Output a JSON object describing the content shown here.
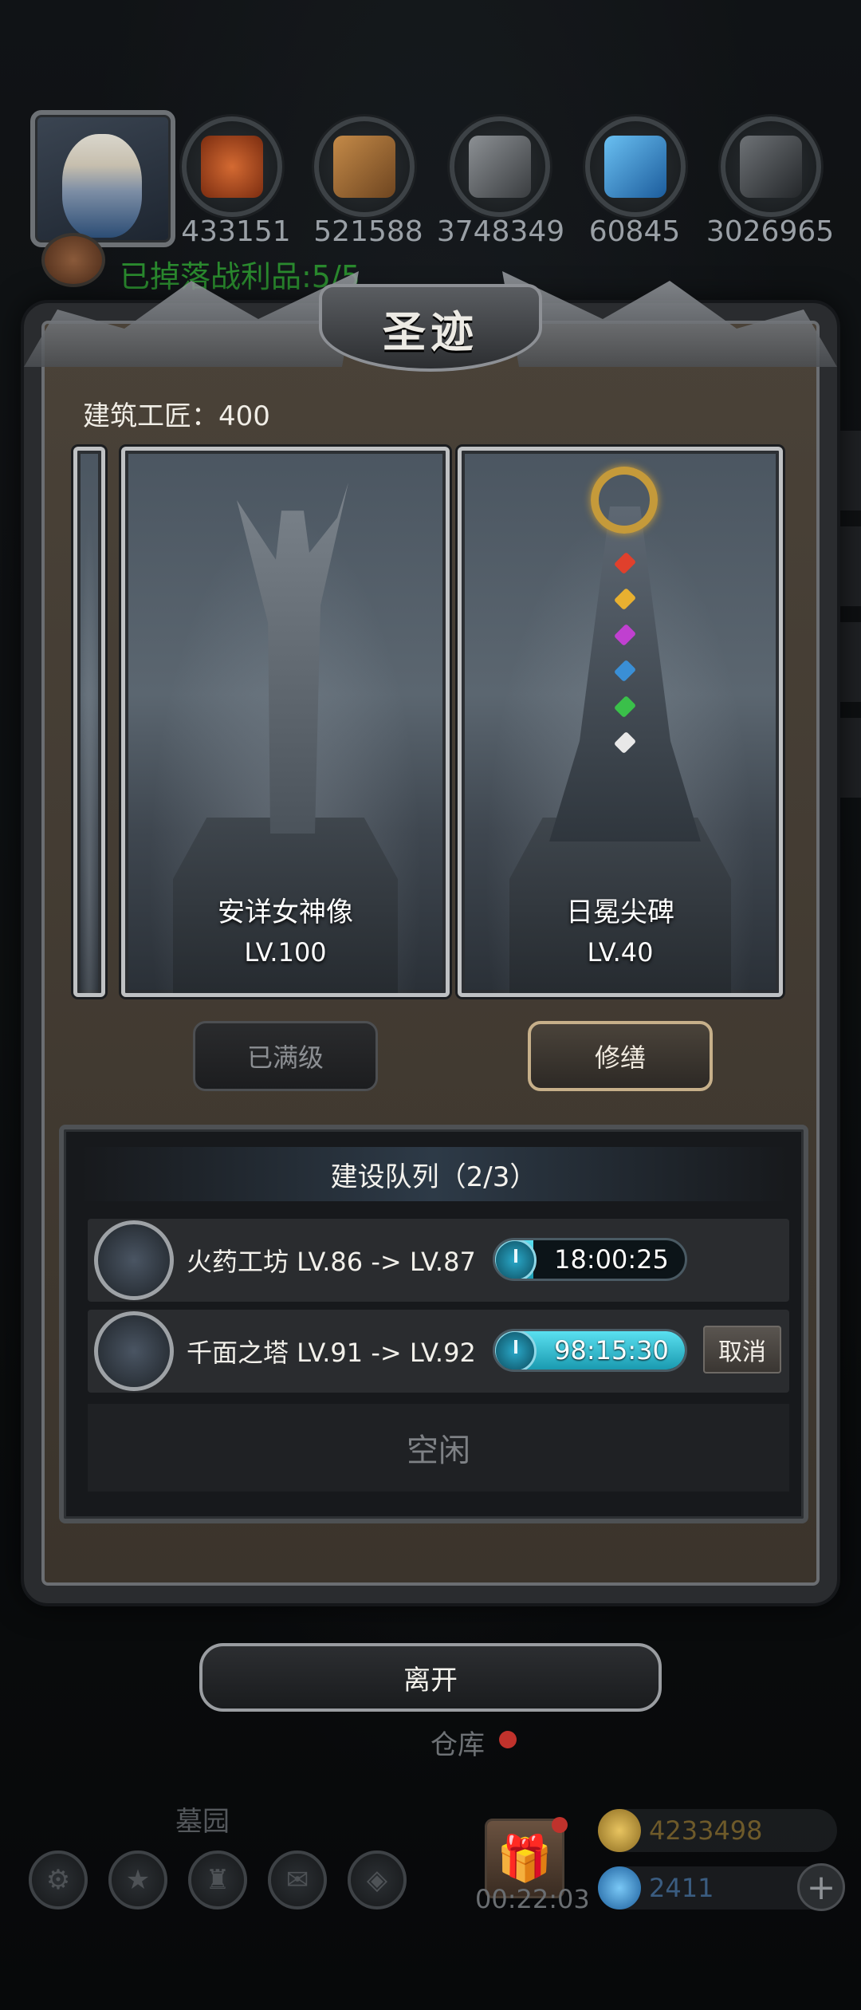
{
  "top_bar": {
    "resources": [
      {
        "icon": "meat-icon",
        "value": "433151",
        "color": "#c45a2a"
      },
      {
        "icon": "wood-icon",
        "value": "521588",
        "color": "#b9803f"
      },
      {
        "icon": "iron-icon",
        "value": "3748349",
        "color": "#6d7175"
      },
      {
        "icon": "crystal-icon",
        "value": "60845",
        "color": "#3a8fd6"
      },
      {
        "icon": "steel-icon",
        "value": "3026965",
        "color": "#55595d"
      }
    ],
    "loot_status": "已掉落战利品:5/5"
  },
  "dialog": {
    "title": "圣迹",
    "builder_label": "建筑工匠：400",
    "monuments": [
      {
        "name": "安详女神像",
        "level": "LV.100",
        "button": "已满级",
        "icon": "angel-statue-icon"
      },
      {
        "name": "日冕尖碑",
        "level": "LV.40",
        "button": "修缮",
        "icon": "obelisk-icon"
      }
    ],
    "queue": {
      "title": "建设队列（2/3）",
      "items": [
        {
          "label": "火药工坊 LV.86 -> LV.87",
          "time": "18:00:25",
          "progress": 0.2,
          "icon": "gunpowder-workshop-icon"
        },
        {
          "label": "千面之塔 LV.91 -> LV.92",
          "time": "98:15:30",
          "progress": 1.0,
          "icon": "tower-icon",
          "cancel": "取消"
        }
      ],
      "idle": "空闲"
    },
    "leave": "离开"
  },
  "bottom_hud": {
    "warehouse": "仓库",
    "cemetery": "墓园",
    "gift_timer": "00:22:03",
    "gold": "4233498",
    "gems": "2411",
    "colors": {
      "gold": "#d4a53a",
      "gem": "#3a8fd6"
    }
  }
}
